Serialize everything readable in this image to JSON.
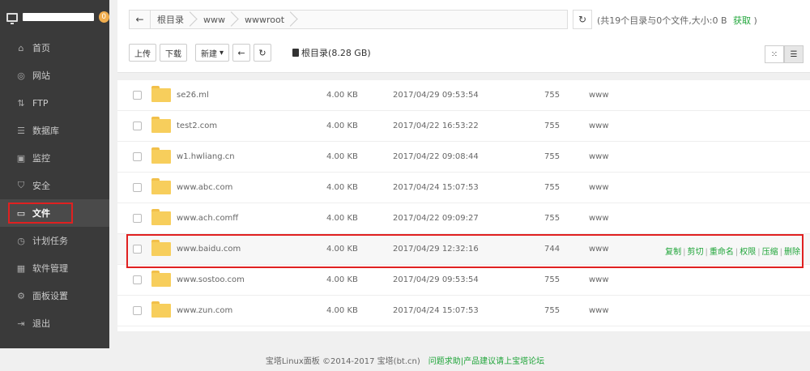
{
  "sidebar": {
    "notification_count": "0",
    "items": [
      {
        "label": "首页",
        "icon": "home-icon"
      },
      {
        "label": "网站",
        "icon": "globe-icon"
      },
      {
        "label": "FTP",
        "icon": "ftp-icon"
      },
      {
        "label": "数据库",
        "icon": "database-icon"
      },
      {
        "label": "监控",
        "icon": "monitor-icon"
      },
      {
        "label": "安全",
        "icon": "shield-icon"
      },
      {
        "label": "文件",
        "icon": "folder-icon",
        "active": true
      },
      {
        "label": "计划任务",
        "icon": "clock-icon"
      },
      {
        "label": "软件管理",
        "icon": "apps-icon"
      },
      {
        "label": "面板设置",
        "icon": "gear-icon"
      },
      {
        "label": "退出",
        "icon": "logout-icon"
      }
    ]
  },
  "pathbar": {
    "crumbs": [
      "根目录",
      "www",
      "wwwroot"
    ],
    "summary": "(共19个目录与0个文件,大小:0 B",
    "summary_link": "获取",
    "summary_end": ")"
  },
  "toolbar": {
    "upload": "上传",
    "download": "下载",
    "new": "新建",
    "new_caret": "▾",
    "disk_label": "根目录(8.28 GB)"
  },
  "files": [
    {
      "name": "se26.ml",
      "size": "4.00 KB",
      "time": "2017/04/29 09:53:54",
      "perm": "755",
      "owner": "www"
    },
    {
      "name": "test2.com",
      "size": "4.00 KB",
      "time": "2017/04/22 16:53:22",
      "perm": "755",
      "owner": "www"
    },
    {
      "name": "w1.hwliang.cn",
      "size": "4.00 KB",
      "time": "2017/04/22 09:08:44",
      "perm": "755",
      "owner": "www"
    },
    {
      "name": "www.abc.com",
      "size": "4.00 KB",
      "time": "2017/04/24 15:07:53",
      "perm": "755",
      "owner": "www"
    },
    {
      "name": "www.ach.comff",
      "size": "4.00 KB",
      "time": "2017/04/22 09:09:27",
      "perm": "755",
      "owner": "www"
    },
    {
      "name": "www.baidu.com",
      "size": "4.00 KB",
      "time": "2017/04/29 12:32:16",
      "perm": "744",
      "owner": "www"
    },
    {
      "name": "www.sostoo.com",
      "size": "4.00 KB",
      "time": "2017/04/29 09:53:54",
      "perm": "755",
      "owner": "www"
    },
    {
      "name": "www.zun.com",
      "size": "4.00 KB",
      "time": "2017/04/24 15:07:53",
      "perm": "755",
      "owner": "www"
    }
  ],
  "row_ops": {
    "copy": "复制",
    "cut": "剪切",
    "rename": "重命名",
    "perm": "权限",
    "compress": "压缩",
    "delete": "删除",
    "sep": "|"
  },
  "footer": {
    "copyright": "宝塔Linux面板 ©2014-2017 宝塔(bt.cn)",
    "link": "问题求助|产品建议请上宝塔论坛"
  },
  "colors": {
    "accent": "#20a53a",
    "sidebar_bg": "#3a3a3a",
    "highlight_border": "#e02020",
    "folder": "#f7ce5c"
  }
}
